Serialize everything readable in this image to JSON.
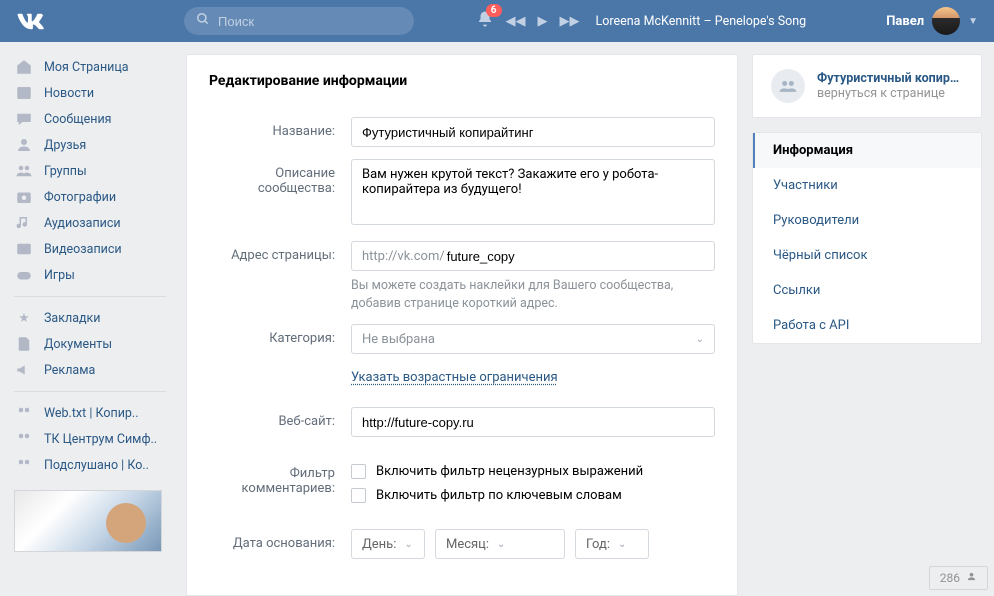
{
  "header": {
    "search_placeholder": "Поиск",
    "notif_count": "6",
    "now_playing": "Loreena McKennitt – Penelope's Song",
    "user_name": "Павел"
  },
  "nav": {
    "items": [
      {
        "icon": "home",
        "label": "Моя Страница"
      },
      {
        "icon": "news",
        "label": "Новости"
      },
      {
        "icon": "msg",
        "label": "Сообщения"
      },
      {
        "icon": "friends",
        "label": "Друзья"
      },
      {
        "icon": "groups",
        "label": "Группы"
      },
      {
        "icon": "photo",
        "label": "Фотографии"
      },
      {
        "icon": "audio",
        "label": "Аудиозаписи"
      },
      {
        "icon": "video",
        "label": "Видеозаписи"
      },
      {
        "icon": "games",
        "label": "Игры"
      }
    ],
    "items2": [
      {
        "icon": "star",
        "label": "Закладки"
      },
      {
        "icon": "doc",
        "label": "Документы"
      },
      {
        "icon": "ad",
        "label": "Реклама"
      }
    ],
    "items3": [
      {
        "icon": "grp",
        "label": "Web.txt | Копир.."
      },
      {
        "icon": "grp",
        "label": "ТК Центрум Симф.."
      },
      {
        "icon": "grp",
        "label": "Подслушано | Ко.."
      }
    ]
  },
  "main": {
    "title": "Редактирование информации",
    "labels": {
      "name": "Название:",
      "desc": "Описание сообщества:",
      "addr": "Адрес страницы:",
      "cat": "Категория:",
      "site": "Веб-сайт:",
      "comm": "Фильтр комментариев:",
      "date": "Дата основания:"
    },
    "values": {
      "name": "Футуристичный копирайтинг",
      "desc": "Вам нужен крутой текст? Закажите его у робота-копирайтера из будущего!",
      "url_prefix": "http://vk.com/",
      "url_value": "future_copy",
      "addr_hint": "Вы можете создать наклейки для Вашего сообщества, добавив странице короткий адрес.",
      "cat": "Не выбрана",
      "age_link": "Указать возрастные ограничения",
      "site": "http://future-copy.ru",
      "filter1": "Включить фильтр нецензурных выражений",
      "filter2": "Включить фильтр по ключевым словам",
      "day": "День:",
      "month": "Месяц:",
      "year": "Год:"
    }
  },
  "right": {
    "group_name": "Футуристичный копирай...",
    "back": "вернуться к странице",
    "tabs": [
      "Информация",
      "Участники",
      "Руководители",
      "Чёрный список",
      "Ссылки",
      "Работа с API"
    ]
  },
  "counter": "286"
}
